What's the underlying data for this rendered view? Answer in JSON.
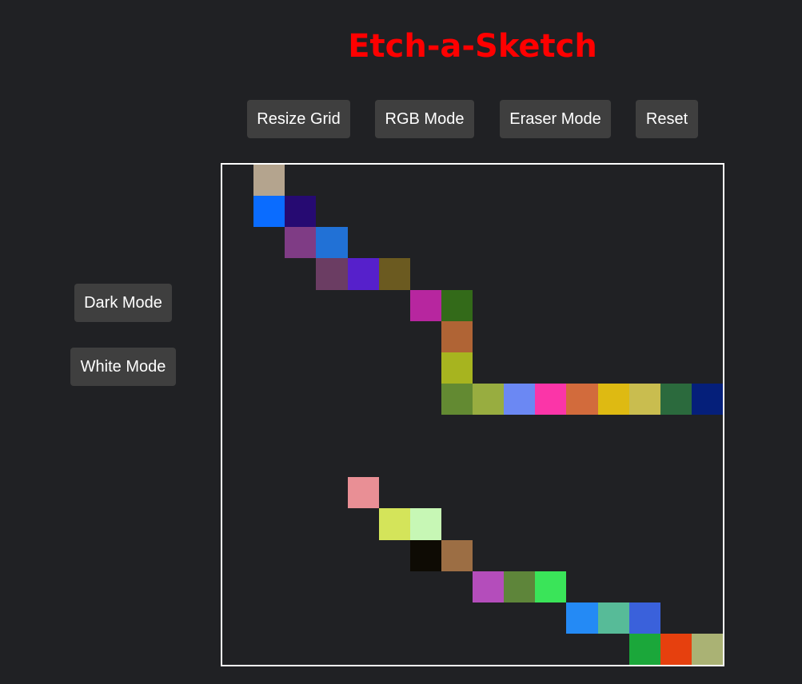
{
  "header": {
    "title": "Etch-a-Sketch",
    "title_color": "#ff0000"
  },
  "toolbar": {
    "resize_label": "Resize Grid",
    "rgb_label": "RGB Mode",
    "eraser_label": "Eraser Mode",
    "reset_label": "Reset"
  },
  "side_panel": {
    "dark_label": "Dark Mode",
    "white_label": "White Mode"
  },
  "grid": {
    "size": 16,
    "background_color": "#202124",
    "border_color": "#ffffff",
    "painted_cells": [
      {
        "row": 0,
        "col": 1,
        "color": "#b4a48e"
      },
      {
        "row": 1,
        "col": 1,
        "color": "#0a6cff"
      },
      {
        "row": 1,
        "col": 2,
        "color": "#260a72"
      },
      {
        "row": 2,
        "col": 2,
        "color": "#7f3c85"
      },
      {
        "row": 2,
        "col": 3,
        "color": "#2171d6"
      },
      {
        "row": 3,
        "col": 3,
        "color": "#6b3d63"
      },
      {
        "row": 3,
        "col": 4,
        "color": "#5620cb"
      },
      {
        "row": 3,
        "col": 5,
        "color": "#6b5a20"
      },
      {
        "row": 4,
        "col": 6,
        "color": "#b7269f"
      },
      {
        "row": 4,
        "col": 7,
        "color": "#336a19"
      },
      {
        "row": 5,
        "col": 7,
        "color": "#b06435"
      },
      {
        "row": 6,
        "col": 7,
        "color": "#a7b41f"
      },
      {
        "row": 7,
        "col": 7,
        "color": "#638a32"
      },
      {
        "row": 7,
        "col": 8,
        "color": "#98ad40"
      },
      {
        "row": 7,
        "col": 9,
        "color": "#6b88f3"
      },
      {
        "row": 7,
        "col": 10,
        "color": "#fb35a8"
      },
      {
        "row": 7,
        "col": 11,
        "color": "#d26b3c"
      },
      {
        "row": 7,
        "col": 12,
        "color": "#deba12"
      },
      {
        "row": 7,
        "col": 13,
        "color": "#c9bd4f"
      },
      {
        "row": 7,
        "col": 14,
        "color": "#2b6a3d"
      },
      {
        "row": 7,
        "col": 15,
        "color": "#051f7a"
      },
      {
        "row": 10,
        "col": 4,
        "color": "#e98f95"
      },
      {
        "row": 11,
        "col": 5,
        "color": "#d4e45a"
      },
      {
        "row": 11,
        "col": 6,
        "color": "#c7f7b5"
      },
      {
        "row": 12,
        "col": 6,
        "color": "#0e0b04"
      },
      {
        "row": 12,
        "col": 7,
        "color": "#9c6e44"
      },
      {
        "row": 13,
        "col": 8,
        "color": "#b44dbb"
      },
      {
        "row": 13,
        "col": 9,
        "color": "#5e853a"
      },
      {
        "row": 13,
        "col": 10,
        "color": "#3ae459"
      },
      {
        "row": 14,
        "col": 11,
        "color": "#248af5"
      },
      {
        "row": 14,
        "col": 12,
        "color": "#57bb98"
      },
      {
        "row": 14,
        "col": 13,
        "color": "#3a61db"
      },
      {
        "row": 15,
        "col": 13,
        "color": "#1ba73a"
      },
      {
        "row": 15,
        "col": 14,
        "color": "#e6400e"
      },
      {
        "row": 15,
        "col": 15,
        "color": "#aab274"
      }
    ]
  }
}
